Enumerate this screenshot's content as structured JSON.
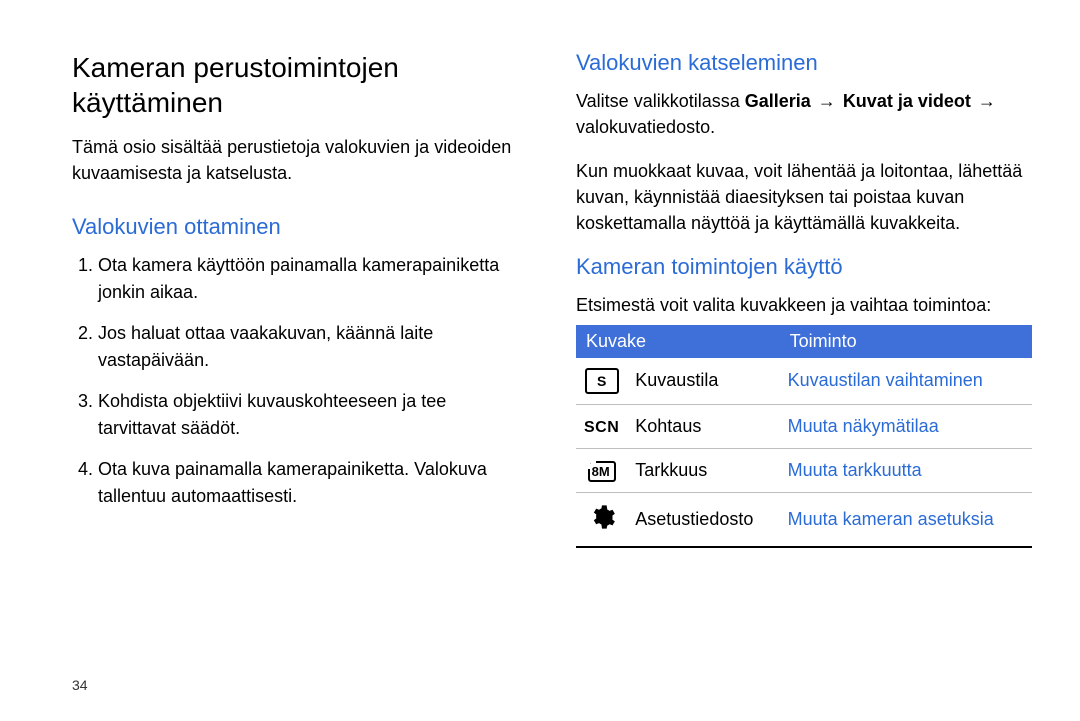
{
  "page_number": "34",
  "left": {
    "title": "Kameran perustoimintojen käyttäminen",
    "intro": "Tämä osio sisältää perustietoja valokuvien ja videoiden kuvaamisesta ja katselusta.",
    "section1": {
      "heading": "Valokuvien ottaminen",
      "steps": [
        "Ota kamera käyttöön painamalla kamerapainiketta jonkin aikaa.",
        "Jos haluat ottaa vaakakuvan, käännä laite vastapäivään.",
        "Kohdista objektiivi kuvauskohteeseen ja tee tarvittavat säädöt.",
        "Ota kuva painamalla kamerapainiketta. Valokuva tallentuu automaattisesti."
      ]
    }
  },
  "right": {
    "section2": {
      "heading": "Valokuvien katseleminen",
      "line_prefix": "Valitse valikkotilassa ",
      "bold1": "Galleria",
      "arrow": "→",
      "bold2": "Kuvat ja videot",
      "line_suffix": " valokuvatiedosto.",
      "para2": "Kun muokkaat kuvaa, voit lähentää ja loitontaa, lähettää kuvan, käynnistää diaesityksen tai poistaa kuvan koskettamalla näyttöä ja käyttämällä kuvakkeita."
    },
    "section3": {
      "heading": "Kameran toimintojen käyttö",
      "intro": "Etsimestä voit valita kuvakkeen ja vaihtaa toimintoa:",
      "table": {
        "head_icon": "Kuvake",
        "head_func": "Toiminto",
        "rows": [
          {
            "label": "Kuvaustila",
            "action": "Kuvaustilan vaihtaminen",
            "icon": "s-box"
          },
          {
            "label": "Kohtaus",
            "action": "Muuta näkymätilaa",
            "icon": "scn"
          },
          {
            "label": "Tarkkuus",
            "action": "Muuta tarkkuutta",
            "icon": "8m"
          },
          {
            "label": "Asetustiedosto",
            "action": "Muuta kameran asetuksia",
            "icon": "gear"
          }
        ]
      }
    }
  },
  "chart_data": {
    "type": "table",
    "title": "Kameran toimintojen käyttö",
    "columns": [
      "Kuvake",
      "Toiminto"
    ],
    "rows": [
      [
        "Kuvaustila",
        "Kuvaustilan vaihtaminen"
      ],
      [
        "Kohtaus",
        "Muuta näkymätilaa"
      ],
      [
        "Tarkkuus",
        "Muuta tarkkuutta"
      ],
      [
        "Asetustiedosto",
        "Muuta kameran asetuksia"
      ]
    ]
  }
}
